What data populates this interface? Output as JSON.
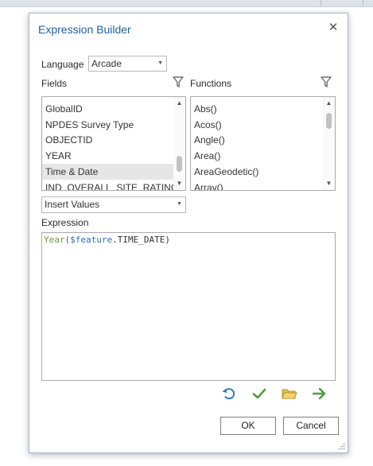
{
  "dialog": {
    "title": "Expression Builder",
    "close_glyph": "✕"
  },
  "language": {
    "label": "Language",
    "value": "Arcade"
  },
  "fields": {
    "label": "Fields",
    "items": [
      "GlobalID",
      "NPDES Survey Type",
      "OBJECTID",
      "YEAR",
      "Time & Date",
      "IND_OVERALL_SITE_RATING"
    ],
    "selected_index": 4
  },
  "functions": {
    "label": "Functions",
    "items": [
      "Abs()",
      "Acos()",
      "Angle()",
      "Area()",
      "AreaGeodetic()",
      "Array()"
    ]
  },
  "insert": {
    "value": "Insert Values"
  },
  "expression": {
    "label": "Expression",
    "fn": "Year",
    "open": "(",
    "var": "$feature",
    "rest": ".TIME_DATE)"
  },
  "buttons": {
    "ok": "OK",
    "cancel": "Cancel"
  },
  "icons": {
    "filter": "filter-icon",
    "undo": "undo-icon",
    "verify": "checkmark-icon",
    "open": "folder-open-icon",
    "export": "arrow-right-icon"
  },
  "colors": {
    "title": "#1f5f9e",
    "fn_token": "#6b9a3a",
    "var_token": "#2e6fb3",
    "undo": "#2f7bbf",
    "verify": "#4f9e3c",
    "folder": "#d9b233",
    "export": "#4f9e3c"
  }
}
